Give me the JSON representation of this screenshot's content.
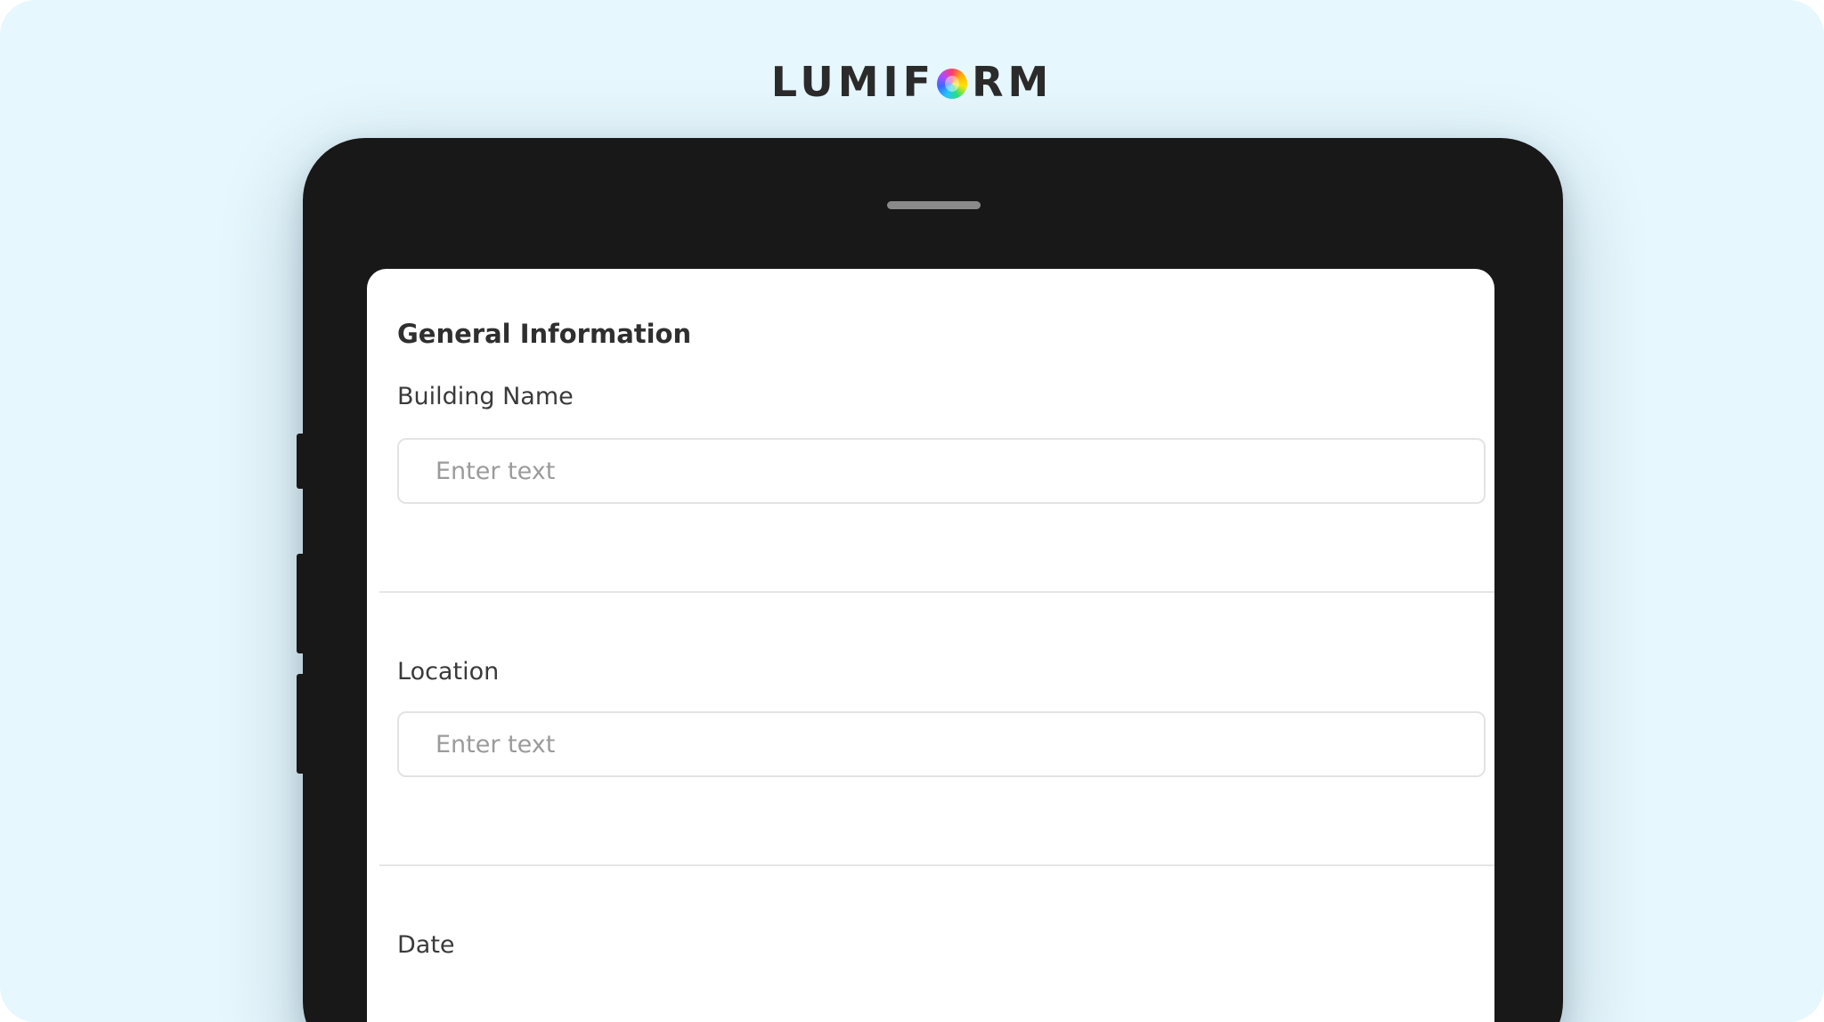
{
  "brand": {
    "logo_prefix": "LUMIF",
    "logo_suffix": "RM"
  },
  "form": {
    "section_title": "General Information",
    "fields": [
      {
        "label": "Building Name",
        "placeholder": "Enter text"
      },
      {
        "label": "Location",
        "placeholder": "Enter text"
      },
      {
        "label": "Date"
      }
    ]
  },
  "colors": {
    "background": "#e6f7fd",
    "device": "#181818",
    "screen": "#ffffff",
    "text": "#2f2f2f",
    "placeholder": "#9b9b9b",
    "border": "#e3e3e3"
  },
  "icons": {
    "logo_mark": "multicolor-o-icon"
  }
}
